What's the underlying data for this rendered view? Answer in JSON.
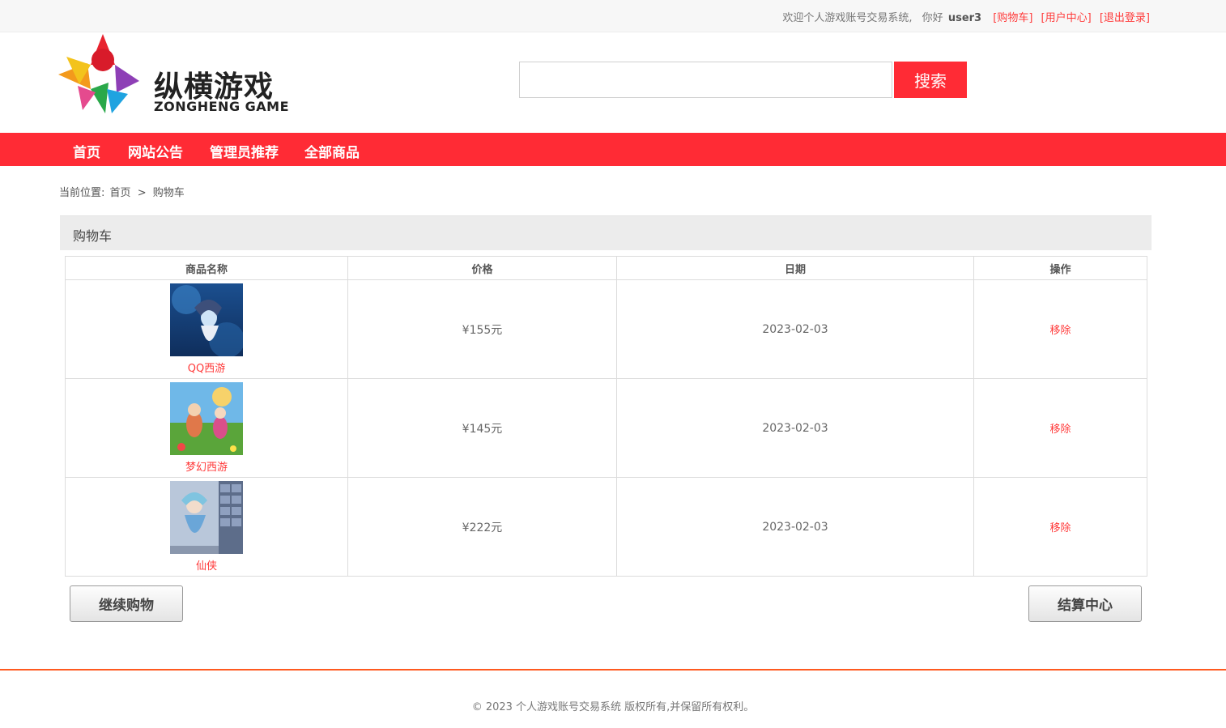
{
  "topbar": {
    "welcome": "欢迎个人游戏账号交易系统,",
    "greeting": "你好",
    "username": "user3",
    "cart_link": "[购物车]",
    "user_center_link": "[用户中心]",
    "logout_link": "[退出登录]"
  },
  "logo": {
    "cn": "纵横游戏",
    "en": "ZONGHENG GAME"
  },
  "search": {
    "placeholder": "",
    "button_label": "搜索"
  },
  "nav": {
    "items": [
      {
        "label": "首页"
      },
      {
        "label": "网站公告"
      },
      {
        "label": "管理员推荐"
      },
      {
        "label": "全部商品"
      }
    ]
  },
  "breadcrumb": {
    "prefix": "当前位置:",
    "home": "首页",
    "separator": ">",
    "current": "购物车"
  },
  "panel": {
    "title": "购物车"
  },
  "table": {
    "headers": {
      "name": "商品名称",
      "price": "价格",
      "date": "日期",
      "action": "操作"
    },
    "rows": [
      {
        "name": "QQ西游",
        "price": "¥155元",
        "date": "2023-02-03",
        "action": "移除"
      },
      {
        "name": "梦幻西游",
        "price": "¥145元",
        "date": "2023-02-03",
        "action": "移除"
      },
      {
        "name": "仙侠",
        "price": "¥222元",
        "date": "2023-02-03",
        "action": "移除"
      }
    ]
  },
  "buttons": {
    "continue": "继续购物",
    "checkout": "结算中心"
  },
  "footer": {
    "copyright": "© 2023 个人游戏账号交易系统 版权所有,并保留所有权利。"
  },
  "colors": {
    "accent": "#ff2b35",
    "link": "#ff3a3a",
    "footer_line": "#ff5a1f"
  }
}
